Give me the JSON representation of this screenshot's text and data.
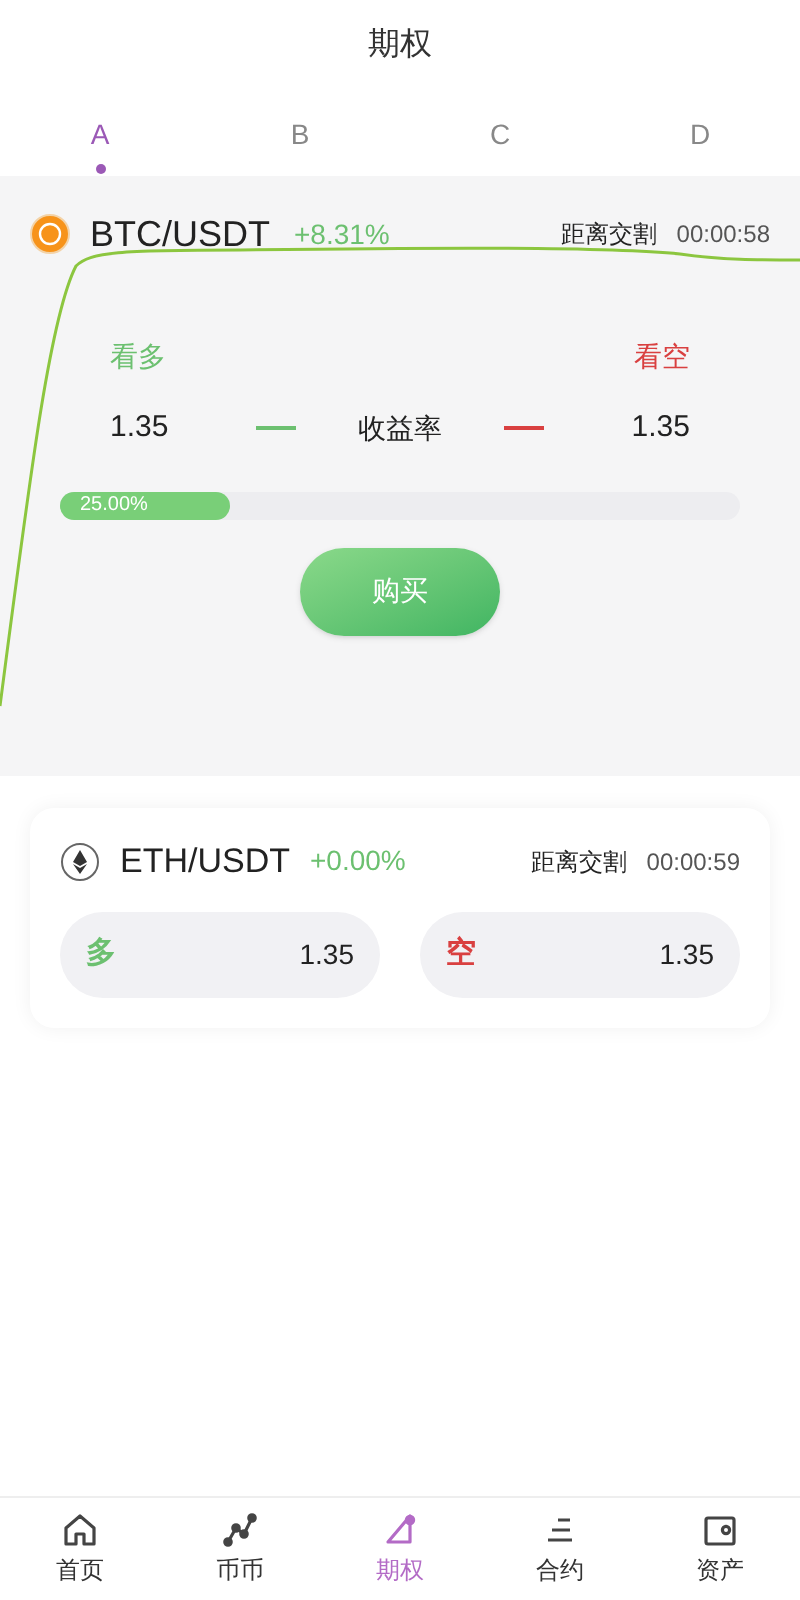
{
  "header": {
    "title": "期权"
  },
  "tabs": [
    {
      "label": "A",
      "selected": true
    },
    {
      "label": "B",
      "selected": false
    },
    {
      "label": "C",
      "selected": false
    },
    {
      "label": "D",
      "selected": false
    }
  ],
  "featured": {
    "pair": "BTC/USDT",
    "change": "+8.31%",
    "countdown_label": "距离交割",
    "countdown": "00:00:58",
    "long_label": "看多",
    "short_label": "看空",
    "long_rate": "1.35",
    "rate_label": "收益率",
    "short_rate": "1.35",
    "progress": {
      "level": 0.25,
      "reading": "25.00%"
    },
    "buy_button": "购买"
  },
  "markets": [
    {
      "pair": "ETH/USDT",
      "change": "+0.00%",
      "countdown_label": "距离交割",
      "countdown": "00:00:59",
      "long_label": "多",
      "long_rate": "1.35",
      "short_label": "空",
      "short_rate": "1.35"
    }
  ],
  "bottom_nav": [
    {
      "label": "首页",
      "kind": "home",
      "selected": false
    },
    {
      "label": "币币",
      "kind": "nodes",
      "selected": false
    },
    {
      "label": "期权",
      "kind": "triangle",
      "selected": true
    },
    {
      "label": "合约",
      "kind": "bars",
      "selected": false
    },
    {
      "label": "资产",
      "kind": "wallet",
      "selected": false
    }
  ]
}
